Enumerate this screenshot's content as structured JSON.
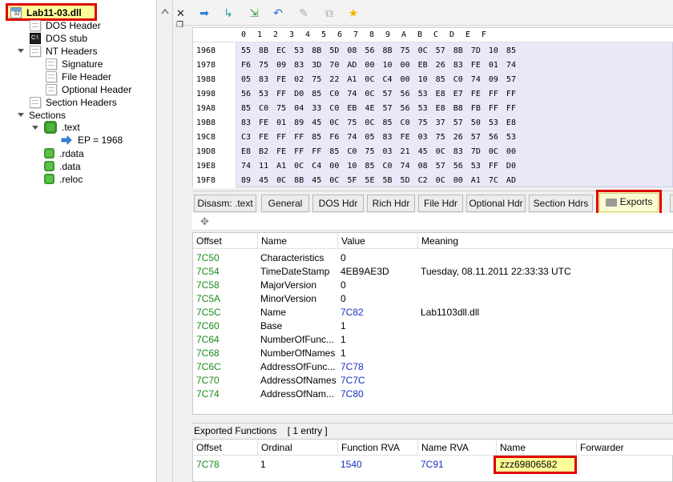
{
  "tree": {
    "root": "Lab11-03.dll",
    "items": [
      {
        "label": "DOS Header",
        "icon": "page-icon"
      },
      {
        "label": "DOS stub",
        "icon": "terminal-icon"
      },
      {
        "label": "NT Headers",
        "icon": "page-icon"
      },
      {
        "label": "Signature",
        "icon": "page-icon"
      },
      {
        "label": "File Header",
        "icon": "page-icon"
      },
      {
        "label": "Optional Header",
        "icon": "page-icon"
      },
      {
        "label": "Section Headers",
        "icon": "page-icon"
      },
      {
        "label": "Sections",
        "icon": ""
      },
      {
        "label": ".text",
        "icon": "gear-icon"
      },
      {
        "label": "EP = 1968",
        "icon": "arrow-right-icon"
      },
      {
        "label": ".rdata",
        "icon": "gear-icon"
      },
      {
        "label": ".data",
        "icon": "gear-icon"
      },
      {
        "label": ".reloc",
        "icon": "gear-icon"
      }
    ]
  },
  "hex": {
    "columns": [
      "0",
      "1",
      "2",
      "3",
      "4",
      "5",
      "6",
      "7",
      "8",
      "9",
      "A",
      "B",
      "C",
      "D",
      "E",
      "F"
    ],
    "rows": [
      {
        "addr": "1968",
        "bytes": "55 8B EC 53 8B 5D 08 56 8B 75 0C 57 8B 7D 10 85"
      },
      {
        "addr": "1978",
        "bytes": "F6 75 09 83 3D 70 AD 00 10 00 EB 26 83 FE 01 74"
      },
      {
        "addr": "1988",
        "bytes": "05 83 FE 02 75 22 A1 0C C4 00 10 85 C0 74 09 57"
      },
      {
        "addr": "1998",
        "bytes": "56 53 FF D0 85 C0 74 0C 57 56 53 E8 E7 FE FF FF"
      },
      {
        "addr": "19A8",
        "bytes": "85 C0 75 04 33 C0 EB 4E 57 56 53 E8 B8 FB FF FF"
      },
      {
        "addr": "19B8",
        "bytes": "83 FE 01 89 45 0C 75 0C 85 C0 75 37 57 50 53 E8"
      },
      {
        "addr": "19C8",
        "bytes": "C3 FE FF FF 85 F6 74 05 83 FE 03 75 26 57 56 53"
      },
      {
        "addr": "19D8",
        "bytes": "E8 B2 FE FF FF 85 C0 75 03 21 45 0C 83 7D 0C 00"
      },
      {
        "addr": "19E8",
        "bytes": "74 11 A1 0C C4 00 10 85 C0 74 08 57 56 53 FF D0"
      },
      {
        "addr": "19F8",
        "bytes": "89 45 0C 8B 45 0C 5F 5E 5B 5D C2 0C 00 A1 7C AD"
      }
    ]
  },
  "tabs": [
    "Disasm: .text",
    "General",
    "DOS Hdr",
    "Rich Hdr",
    "File Hdr",
    "Optional Hdr",
    "Section Hdrs",
    "Exports"
  ],
  "active_tab": "Exports",
  "exports": {
    "headers": [
      "Offset",
      "Name",
      "Value",
      "Meaning"
    ],
    "rows": [
      {
        "offset": "7C50",
        "name": "Characteristics",
        "value": "0",
        "meaning": ""
      },
      {
        "offset": "7C54",
        "name": "TimeDateStamp",
        "value": "4EB9AE3D",
        "meaning": "Tuesday, 08.11.2011 22:33:33 UTC"
      },
      {
        "offset": "7C58",
        "name": "MajorVersion",
        "value": "0",
        "meaning": ""
      },
      {
        "offset": "7C5A",
        "name": "MinorVersion",
        "value": "0",
        "meaning": ""
      },
      {
        "offset": "7C5C",
        "name": "Name",
        "value": "7C82",
        "meaning": "Lab1103dll.dll"
      },
      {
        "offset": "7C60",
        "name": "Base",
        "value": "1",
        "meaning": ""
      },
      {
        "offset": "7C64",
        "name": "NumberOfFunc...",
        "value": "1",
        "meaning": ""
      },
      {
        "offset": "7C68",
        "name": "NumberOfNames",
        "value": "1",
        "meaning": ""
      },
      {
        "offset": "7C6C",
        "name": "AddressOfFunc...",
        "value": "7C78",
        "meaning": ""
      },
      {
        "offset": "7C70",
        "name": "AddressOfNames",
        "value": "7C7C",
        "meaning": ""
      },
      {
        "offset": "7C74",
        "name": "AddressOfNam...",
        "value": "7C80",
        "meaning": ""
      }
    ]
  },
  "exported_functions": {
    "label": "Exported Functions",
    "count": "[ 1 entry ]",
    "headers": [
      "Offset",
      "Ordinal",
      "Function RVA",
      "Name RVA",
      "Name",
      "Forwarder"
    ],
    "rows": [
      {
        "offset": "7C78",
        "ordinal": "1",
        "function_rva": "1540",
        "name_rva": "7C91",
        "name": "zzz69806582",
        "forwarder": ""
      }
    ]
  },
  "colors": {
    "highlight_border": "#e00000",
    "highlight_fill": "#ffff99",
    "offset_green": "#1a8a1a",
    "link_blue": "#1a2fbf",
    "hex_bg": "#e8e8f8"
  }
}
